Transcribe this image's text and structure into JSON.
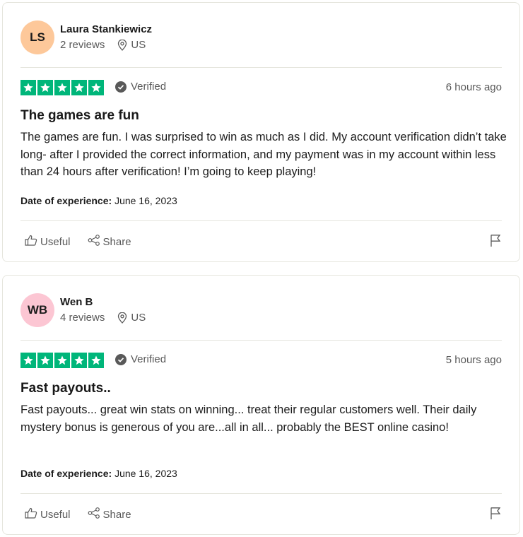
{
  "reviews": [
    {
      "initials": "LS",
      "avatar_color": "#fdc89a",
      "name": "Laura Stankiewicz",
      "review_count": "2 reviews",
      "country": "US",
      "verified": "Verified",
      "time_ago": "6 hours ago",
      "title": "The games are fun",
      "body": "The games are fun. I was surprised to win as much as I did. My account verification didn’t take long- after I provided the correct information, and my payment was in my account within less than 24 hours after verification! I’m going to keep playing!",
      "date_label": "Date of experience:",
      "date_value": "June 16, 2023",
      "rating": 5
    },
    {
      "initials": "WB",
      "avatar_color": "#fcc6d3",
      "name": "Wen B",
      "review_count": "4 reviews",
      "country": "US",
      "verified": "Verified",
      "time_ago": "5 hours ago",
      "title": "Fast payouts..",
      "body": "Fast payouts... great win stats on winning... treat their regular customers well. Their daily mystery bonus is generous of you are...all in all... probably the BEST online casino!",
      "date_label": "Date of experience:",
      "date_value": "June 16, 2023",
      "rating": 5
    }
  ],
  "actions": {
    "useful": "Useful",
    "share": "Share"
  },
  "colors": {
    "star_green": "#00b67a",
    "divider": "#e5e5dd"
  }
}
